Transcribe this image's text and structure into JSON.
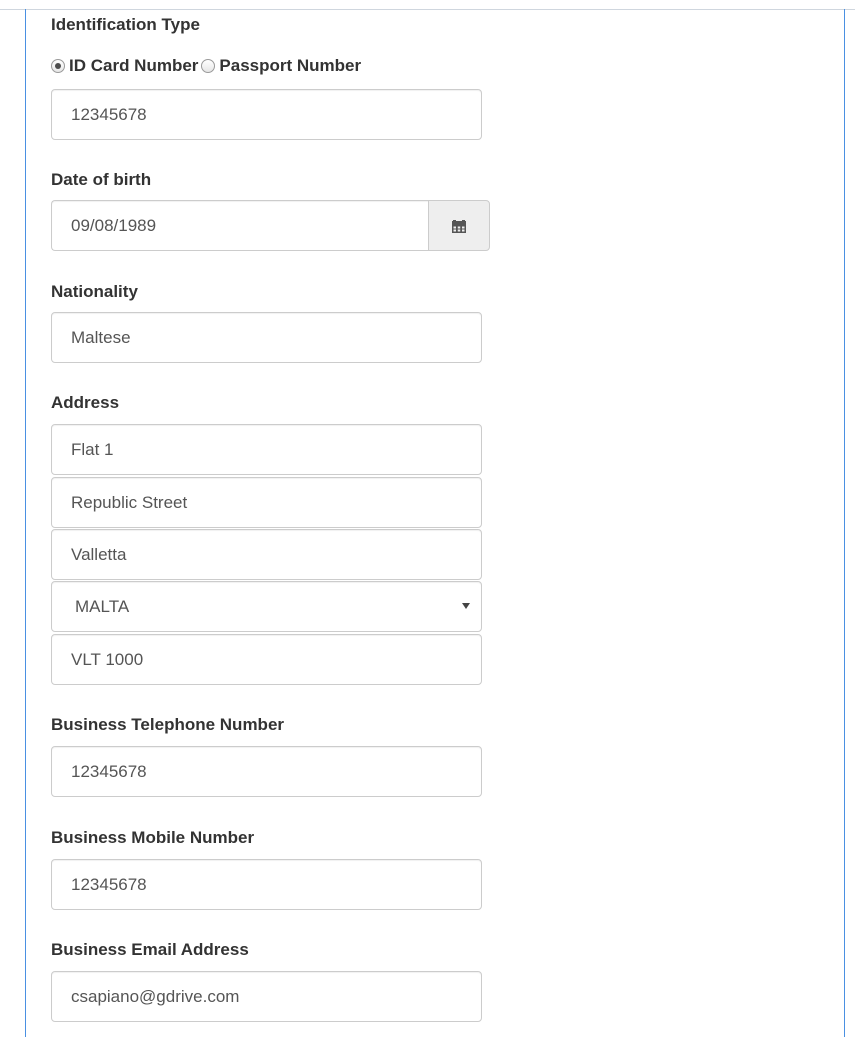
{
  "form": {
    "identification": {
      "label": "Identification Type",
      "options": [
        {
          "label": "ID Card Number",
          "selected": true
        },
        {
          "label": "Passport Number",
          "selected": false
        }
      ],
      "value": "12345678"
    },
    "date_of_birth": {
      "label": "Date of birth",
      "value": "09/08/1989",
      "icon": "calendar-icon"
    },
    "nationality": {
      "label": "Nationality",
      "value": "Maltese"
    },
    "address": {
      "label": "Address",
      "line1": "Flat 1",
      "line2": "Republic Street",
      "city": "Valletta",
      "country": "MALTA",
      "postcode": "VLT 1000"
    },
    "business_telephone": {
      "label": "Business Telephone Number",
      "value": "12345678"
    },
    "business_mobile": {
      "label": "Business Mobile Number",
      "value": "12345678"
    },
    "business_email": {
      "label": "Business Email Address",
      "value": "csapiano@gdrive.com"
    }
  },
  "colors": {
    "panel_border": "#4a90e2",
    "input_border": "#cccccc",
    "addon_background": "#eeeeee"
  }
}
